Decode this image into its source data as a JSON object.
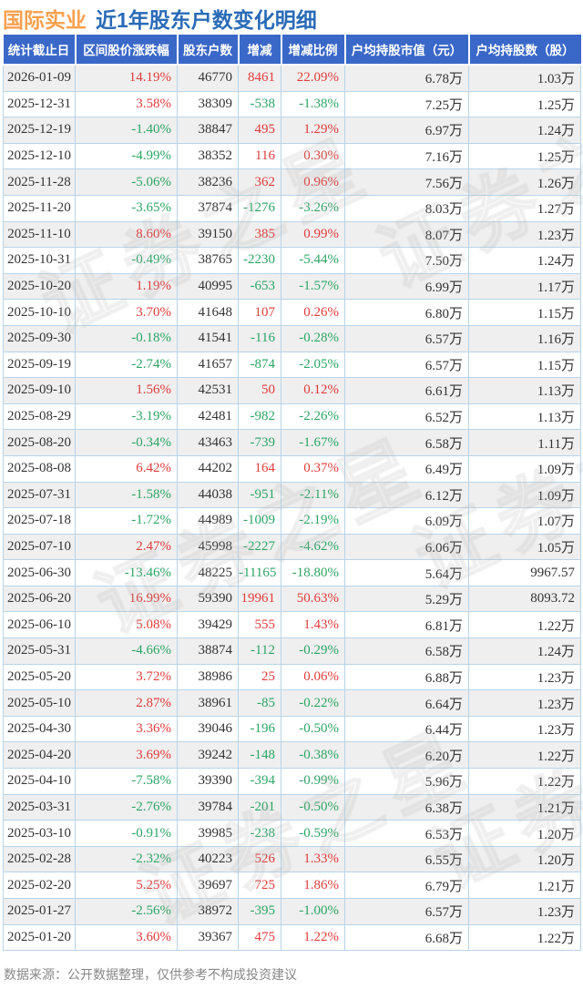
{
  "title": {
    "stock_name": "国际实业",
    "subtitle": "近1年股东户数变化明细"
  },
  "footer": {
    "text": "数据来源：公开数据整理，仅供参考不构成投资建议"
  },
  "watermark": {
    "text": "证券之星"
  },
  "colors": {
    "header_bg": "#3a68c8",
    "positive": "#e33c3c",
    "negative": "#2ea565",
    "title_stock": "#f9a04e",
    "title_rest": "#2a6bb7",
    "border": "#b9d4e9",
    "row_alt": "#efefef",
    "text": "#333333",
    "footer_text": "#888888"
  },
  "chart_data": {
    "type": "table",
    "title": "国际实业 近1年股东户数变化明细",
    "columns": [
      "统计截止日",
      "区间股价涨跌幅",
      "股东户数",
      "增减",
      "增减比例",
      "户均持股市值（元）",
      "户均持股数（股）"
    ],
    "rows": [
      {
        "date": "2026-01-09",
        "change_pct": "14.19%",
        "holders": "46770",
        "delta": "8461",
        "delta_pct": "22.09%",
        "avg_value": "6.78万",
        "avg_shares": "1.03万"
      },
      {
        "date": "2025-12-31",
        "change_pct": "3.58%",
        "holders": "38309",
        "delta": "-538",
        "delta_pct": "-1.38%",
        "avg_value": "7.25万",
        "avg_shares": "1.25万"
      },
      {
        "date": "2025-12-19",
        "change_pct": "-1.40%",
        "holders": "38847",
        "delta": "495",
        "delta_pct": "1.29%",
        "avg_value": "6.97万",
        "avg_shares": "1.24万"
      },
      {
        "date": "2025-12-10",
        "change_pct": "-4.99%",
        "holders": "38352",
        "delta": "116",
        "delta_pct": "0.30%",
        "avg_value": "7.16万",
        "avg_shares": "1.25万"
      },
      {
        "date": "2025-11-28",
        "change_pct": "-5.06%",
        "holders": "38236",
        "delta": "362",
        "delta_pct": "0.96%",
        "avg_value": "7.56万",
        "avg_shares": "1.26万"
      },
      {
        "date": "2025-11-20",
        "change_pct": "-3.65%",
        "holders": "37874",
        "delta": "-1276",
        "delta_pct": "-3.26%",
        "avg_value": "8.03万",
        "avg_shares": "1.27万"
      },
      {
        "date": "2025-11-10",
        "change_pct": "8.60%",
        "holders": "39150",
        "delta": "385",
        "delta_pct": "0.99%",
        "avg_value": "8.07万",
        "avg_shares": "1.23万"
      },
      {
        "date": "2025-10-31",
        "change_pct": "-0.49%",
        "holders": "38765",
        "delta": "-2230",
        "delta_pct": "-5.44%",
        "avg_value": "7.50万",
        "avg_shares": "1.24万"
      },
      {
        "date": "2025-10-20",
        "change_pct": "1.19%",
        "holders": "40995",
        "delta": "-653",
        "delta_pct": "-1.57%",
        "avg_value": "6.99万",
        "avg_shares": "1.17万"
      },
      {
        "date": "2025-10-10",
        "change_pct": "3.70%",
        "holders": "41648",
        "delta": "107",
        "delta_pct": "0.26%",
        "avg_value": "6.80万",
        "avg_shares": "1.15万"
      },
      {
        "date": "2025-09-30",
        "change_pct": "-0.18%",
        "holders": "41541",
        "delta": "-116",
        "delta_pct": "-0.28%",
        "avg_value": "6.57万",
        "avg_shares": "1.16万"
      },
      {
        "date": "2025-09-19",
        "change_pct": "-2.74%",
        "holders": "41657",
        "delta": "-874",
        "delta_pct": "-2.05%",
        "avg_value": "6.57万",
        "avg_shares": "1.15万"
      },
      {
        "date": "2025-09-10",
        "change_pct": "1.56%",
        "holders": "42531",
        "delta": "50",
        "delta_pct": "0.12%",
        "avg_value": "6.61万",
        "avg_shares": "1.13万"
      },
      {
        "date": "2025-08-29",
        "change_pct": "-3.19%",
        "holders": "42481",
        "delta": "-982",
        "delta_pct": "-2.26%",
        "avg_value": "6.52万",
        "avg_shares": "1.13万"
      },
      {
        "date": "2025-08-20",
        "change_pct": "-0.34%",
        "holders": "43463",
        "delta": "-739",
        "delta_pct": "-1.67%",
        "avg_value": "6.58万",
        "avg_shares": "1.11万"
      },
      {
        "date": "2025-08-08",
        "change_pct": "6.42%",
        "holders": "44202",
        "delta": "164",
        "delta_pct": "0.37%",
        "avg_value": "6.49万",
        "avg_shares": "1.09万"
      },
      {
        "date": "2025-07-31",
        "change_pct": "-1.58%",
        "holders": "44038",
        "delta": "-951",
        "delta_pct": "-2.11%",
        "avg_value": "6.12万",
        "avg_shares": "1.09万"
      },
      {
        "date": "2025-07-18",
        "change_pct": "-1.72%",
        "holders": "44989",
        "delta": "-1009",
        "delta_pct": "-2.19%",
        "avg_value": "6.09万",
        "avg_shares": "1.07万"
      },
      {
        "date": "2025-07-10",
        "change_pct": "2.47%",
        "holders": "45998",
        "delta": "-2227",
        "delta_pct": "-4.62%",
        "avg_value": "6.06万",
        "avg_shares": "1.05万"
      },
      {
        "date": "2025-06-30",
        "change_pct": "-13.46%",
        "holders": "48225",
        "delta": "-11165",
        "delta_pct": "-18.80%",
        "avg_value": "5.64万",
        "avg_shares": "9967.57"
      },
      {
        "date": "2025-06-20",
        "change_pct": "16.99%",
        "holders": "59390",
        "delta": "19961",
        "delta_pct": "50.63%",
        "avg_value": "5.29万",
        "avg_shares": "8093.72"
      },
      {
        "date": "2025-06-10",
        "change_pct": "5.08%",
        "holders": "39429",
        "delta": "555",
        "delta_pct": "1.43%",
        "avg_value": "6.81万",
        "avg_shares": "1.22万"
      },
      {
        "date": "2025-05-31",
        "change_pct": "-4.66%",
        "holders": "38874",
        "delta": "-112",
        "delta_pct": "-0.29%",
        "avg_value": "6.58万",
        "avg_shares": "1.24万"
      },
      {
        "date": "2025-05-20",
        "change_pct": "3.72%",
        "holders": "38986",
        "delta": "25",
        "delta_pct": "0.06%",
        "avg_value": "6.88万",
        "avg_shares": "1.23万"
      },
      {
        "date": "2025-05-10",
        "change_pct": "2.87%",
        "holders": "38961",
        "delta": "-85",
        "delta_pct": "-0.22%",
        "avg_value": "6.64万",
        "avg_shares": "1.23万"
      },
      {
        "date": "2025-04-30",
        "change_pct": "3.36%",
        "holders": "39046",
        "delta": "-196",
        "delta_pct": "-0.50%",
        "avg_value": "6.44万",
        "avg_shares": "1.23万"
      },
      {
        "date": "2025-04-20",
        "change_pct": "3.69%",
        "holders": "39242",
        "delta": "-148",
        "delta_pct": "-0.38%",
        "avg_value": "6.20万",
        "avg_shares": "1.22万"
      },
      {
        "date": "2025-04-10",
        "change_pct": "-7.58%",
        "holders": "39390",
        "delta": "-394",
        "delta_pct": "-0.99%",
        "avg_value": "5.96万",
        "avg_shares": "1.22万"
      },
      {
        "date": "2025-03-31",
        "change_pct": "-2.76%",
        "holders": "39784",
        "delta": "-201",
        "delta_pct": "-0.50%",
        "avg_value": "6.38万",
        "avg_shares": "1.21万"
      },
      {
        "date": "2025-03-10",
        "change_pct": "-0.91%",
        "holders": "39985",
        "delta": "-238",
        "delta_pct": "-0.59%",
        "avg_value": "6.53万",
        "avg_shares": "1.20万"
      },
      {
        "date": "2025-02-28",
        "change_pct": "-2.32%",
        "holders": "40223",
        "delta": "526",
        "delta_pct": "1.33%",
        "avg_value": "6.55万",
        "avg_shares": "1.20万"
      },
      {
        "date": "2025-02-20",
        "change_pct": "5.25%",
        "holders": "39697",
        "delta": "725",
        "delta_pct": "1.86%",
        "avg_value": "6.79万",
        "avg_shares": "1.21万"
      },
      {
        "date": "2025-01-27",
        "change_pct": "-2.56%",
        "holders": "38972",
        "delta": "-395",
        "delta_pct": "-1.00%",
        "avg_value": "6.57万",
        "avg_shares": "1.23万"
      },
      {
        "date": "2025-01-20",
        "change_pct": "3.60%",
        "holders": "39367",
        "delta": "475",
        "delta_pct": "1.22%",
        "avg_value": "6.68万",
        "avg_shares": "1.22万"
      }
    ]
  }
}
